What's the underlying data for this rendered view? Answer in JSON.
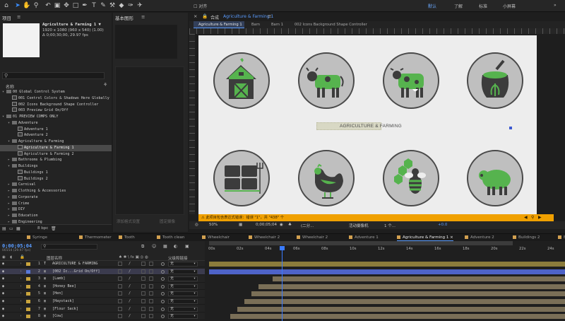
{
  "toolbar": {
    "snap_label": "对齐",
    "workspaces": [
      "默认",
      "了解",
      "标准",
      "小屏幕"
    ]
  },
  "project": {
    "title": "项目",
    "comp_name": "Agriculture & Farming 1 ▼",
    "comp_info_1": "1920 x 1080 (960 x 540) (1.00)",
    "comp_info_2": "Δ 0;00;30;00, 29.97 fps",
    "name_header": "名称",
    "items": [
      {
        "name": "00 Global Control System",
        "type": "folder",
        "level": 0,
        "open": true
      },
      {
        "name": "001 Control Colors & Shadows Here Globally",
        "type": "comp",
        "level": 1
      },
      {
        "name": "002 Icons Background Shape Controller",
        "type": "comp",
        "level": 1
      },
      {
        "name": "003 Preview Grid On/Off",
        "type": "comp",
        "level": 1
      },
      {
        "name": "01 PREVIEW COMPS ONLY",
        "type": "folder",
        "level": 0,
        "open": true
      },
      {
        "name": "Adventure",
        "type": "folder",
        "level": 1,
        "open": true
      },
      {
        "name": "Adventure 1",
        "type": "comp",
        "level": 2
      },
      {
        "name": "Adventure 2",
        "type": "comp",
        "level": 2
      },
      {
        "name": "Agriculture & Farming",
        "type": "folder",
        "level": 1,
        "open": true
      },
      {
        "name": "Agriculture & Farming 1",
        "type": "comp",
        "level": 2,
        "selected": true
      },
      {
        "name": "Agriculture & Farming 2",
        "type": "comp",
        "level": 2
      },
      {
        "name": "Bathrooms & Plumbing",
        "type": "folder",
        "level": 1
      },
      {
        "name": "Buildings",
        "type": "folder",
        "level": 1,
        "open": true
      },
      {
        "name": "Buildings 1",
        "type": "comp",
        "level": 2
      },
      {
        "name": "Buildings 2",
        "type": "comp",
        "level": 2
      },
      {
        "name": "Carnival",
        "type": "folder",
        "level": 1
      },
      {
        "name": "Clothing & Accessories",
        "type": "folder",
        "level": 1
      },
      {
        "name": "Corporate",
        "type": "folder",
        "level": 1
      },
      {
        "name": "Crime",
        "type": "folder",
        "level": 1
      },
      {
        "name": "DIY",
        "type": "folder",
        "level": 1
      },
      {
        "name": "Education",
        "type": "folder",
        "level": 1
      },
      {
        "name": "Engineering",
        "type": "folder",
        "level": 1
      }
    ],
    "bpc": "8 bpc"
  },
  "essential_graphics": {
    "title": "基本图形",
    "footer_left": "添加格式设置",
    "footer_right": "固定摄像"
  },
  "composition": {
    "title": "合成",
    "comp_link": "Agriculture & Farming 1",
    "breadcrumbs": [
      "Agriculture & Farming 1",
      "Barn",
      "Barn 1",
      "002 Icons Background Shape Controller"
    ],
    "label_text": "AGRICULTURE & FARMING",
    "icons": [
      "barn",
      "cow",
      "bull",
      "seed-bag",
      "hay-bales",
      "chicken",
      "bee",
      "sheep"
    ],
    "warning": "此项目包含表达式错误：错误 \"1\"，共 \"438\" 个",
    "zoom": "50%",
    "timecode": "0;00;05;04",
    "resolution": "(二分...",
    "camera": "活动摄像机",
    "views": "1 个...",
    "exposure": "+0.0"
  },
  "tabs": [
    "Syringe",
    "Thermometer",
    "Tooth",
    "Tooth clean",
    "Wheelchair",
    "Wheelchair 2",
    "Wheelchair 2",
    "Adventure 1",
    "Agriculture & Farming 1",
    "Adventure 2",
    "Buildings 2",
    "Bu"
  ],
  "active_tab": "Agriculture & Farming 1",
  "timeline": {
    "timecode": "0;00;05;04",
    "frames": "00154 (29.97 fps)",
    "source_header": "图层名称",
    "parent_header": "父级和链接",
    "time_ticks": [
      "00s",
      "02s",
      "04s",
      "06s",
      "08s",
      "10s",
      "12s",
      "14s",
      "16s",
      "18s",
      "20s",
      "22s",
      "24s"
    ],
    "layers": [
      {
        "num": "1",
        "name": "AGRICULTURE & FARMING",
        "type": "text",
        "label": "#c9a43d",
        "parent": "无"
      },
      {
        "num": "2",
        "name": "[002 Ic...Grid On/Off]",
        "type": "comp",
        "label": "#5878d8",
        "parent": "无",
        "selected": true
      },
      {
        "num": "3",
        "name": "[Lamb]",
        "type": "comp",
        "label": "#c9a43d",
        "parent": "无"
      },
      {
        "num": "4",
        "name": "[Honey Bee]",
        "type": "comp",
        "label": "#c9a43d",
        "parent": "无"
      },
      {
        "num": "5",
        "name": "[Hen]",
        "type": "comp",
        "label": "#c9a43d",
        "parent": "无"
      },
      {
        "num": "6",
        "name": "[Haystack]",
        "type": "comp",
        "label": "#c9a43d",
        "parent": "无"
      },
      {
        "num": "7",
        "name": "[Flour Sack]",
        "type": "comp",
        "label": "#c9a43d",
        "parent": "无"
      },
      {
        "num": "8",
        "name": "[Cow]",
        "type": "comp",
        "label": "#c9a43d",
        "parent": "无"
      }
    ],
    "bar_starts_sec": [
      0,
      0,
      4.5,
      3.5,
      3,
      2.5,
      2,
      1.5
    ]
  }
}
